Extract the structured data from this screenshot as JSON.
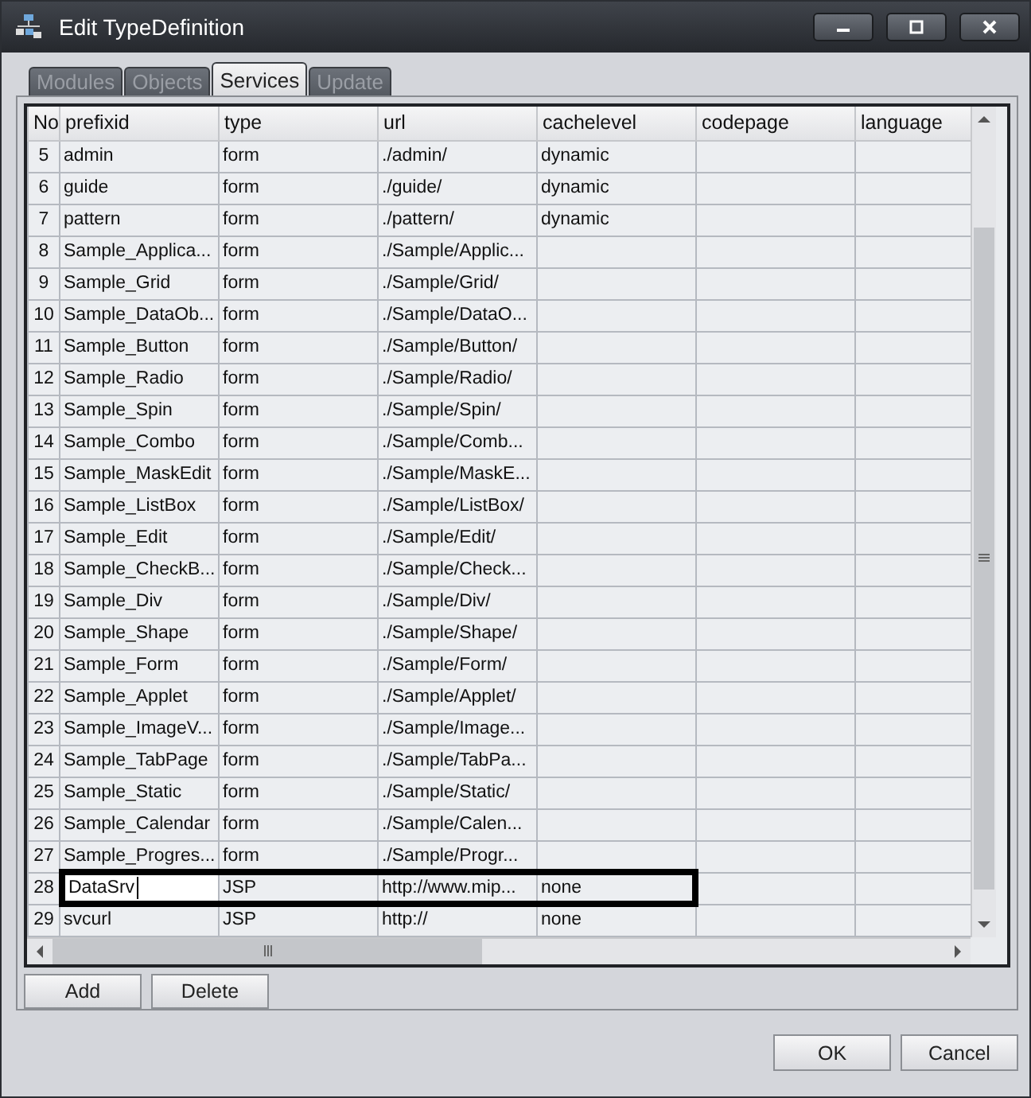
{
  "window": {
    "title": "Edit TypeDefinition"
  },
  "tabs": [
    {
      "label": "Modules",
      "selected": false
    },
    {
      "label": "Objects",
      "selected": false
    },
    {
      "label": "Services",
      "selected": true
    },
    {
      "label": "Update",
      "selected": false
    }
  ],
  "table": {
    "columns": [
      "No",
      "prefixid",
      "type",
      "url",
      "cachelevel",
      "codepage",
      "language"
    ],
    "rows": [
      {
        "no": "5",
        "prefixid": "admin",
        "type": "form",
        "url": "./admin/",
        "cachelevel": "dynamic",
        "editing": false,
        "highlighted": false
      },
      {
        "no": "6",
        "prefixid": "guide",
        "type": "form",
        "url": "./guide/",
        "cachelevel": "dynamic",
        "editing": false,
        "highlighted": false
      },
      {
        "no": "7",
        "prefixid": "pattern",
        "type": "form",
        "url": "./pattern/",
        "cachelevel": "dynamic",
        "editing": false,
        "highlighted": false
      },
      {
        "no": "8",
        "prefixid": "Sample_Applica...",
        "type": "form",
        "url": "./Sample/Applic...",
        "editing": false,
        "highlighted": false
      },
      {
        "no": "9",
        "prefixid": "Sample_Grid",
        "type": "form",
        "url": "./Sample/Grid/",
        "editing": false,
        "highlighted": false
      },
      {
        "no": "10",
        "prefixid": "Sample_DataOb...",
        "type": "form",
        "url": "./Sample/DataO...",
        "editing": false,
        "highlighted": false
      },
      {
        "no": "11",
        "prefixid": "Sample_Button",
        "type": "form",
        "url": "./Sample/Button/",
        "editing": false,
        "highlighted": false
      },
      {
        "no": "12",
        "prefixid": "Sample_Radio",
        "type": "form",
        "url": "./Sample/Radio/",
        "editing": false,
        "highlighted": false
      },
      {
        "no": "13",
        "prefixid": "Sample_Spin",
        "type": "form",
        "url": "./Sample/Spin/",
        "editing": false,
        "highlighted": false
      },
      {
        "no": "14",
        "prefixid": "Sample_Combo",
        "type": "form",
        "url": "./Sample/Comb...",
        "editing": false,
        "highlighted": false
      },
      {
        "no": "15",
        "prefixid": "Sample_MaskEdit",
        "type": "form",
        "url": "./Sample/MaskE...",
        "editing": false,
        "highlighted": false
      },
      {
        "no": "16",
        "prefixid": "Sample_ListBox",
        "type": "form",
        "url": "./Sample/ListBox/",
        "editing": false,
        "highlighted": false
      },
      {
        "no": "17",
        "prefixid": "Sample_Edit",
        "type": "form",
        "url": "./Sample/Edit/",
        "editing": false,
        "highlighted": false
      },
      {
        "no": "18",
        "prefixid": "Sample_CheckB...",
        "type": "form",
        "url": "./Sample/Check...",
        "editing": false,
        "highlighted": false
      },
      {
        "no": "19",
        "prefixid": "Sample_Div",
        "type": "form",
        "url": "./Sample/Div/",
        "editing": false,
        "highlighted": false
      },
      {
        "no": "20",
        "prefixid": "Sample_Shape",
        "type": "form",
        "url": "./Sample/Shape/",
        "editing": false,
        "highlighted": false
      },
      {
        "no": "21",
        "prefixid": "Sample_Form",
        "type": "form",
        "url": "./Sample/Form/",
        "editing": false,
        "highlighted": false
      },
      {
        "no": "22",
        "prefixid": "Sample_Applet",
        "type": "form",
        "url": "./Sample/Applet/",
        "editing": false,
        "highlighted": false
      },
      {
        "no": "23",
        "prefixid": "Sample_ImageV...",
        "type": "form",
        "url": "./Sample/Image...",
        "editing": false,
        "highlighted": false
      },
      {
        "no": "24",
        "prefixid": "Sample_TabPage",
        "type": "form",
        "url": "./Sample/TabPa...",
        "editing": false,
        "highlighted": false
      },
      {
        "no": "25",
        "prefixid": "Sample_Static",
        "type": "form",
        "url": "./Sample/Static/",
        "editing": false,
        "highlighted": false
      },
      {
        "no": "26",
        "prefixid": "Sample_Calendar",
        "type": "form",
        "url": "./Sample/Calen...",
        "editing": false,
        "highlighted": false
      },
      {
        "no": "27",
        "prefixid": "Sample_Progres...",
        "type": "form",
        "url": "./Sample/Progr...",
        "editing": false,
        "highlighted": false
      },
      {
        "no": "28",
        "prefixid": "DataSrv",
        "type": "JSP",
        "url": "http://www.mip...",
        "cachelevel": "none",
        "editing": true,
        "highlighted": true
      },
      {
        "no": "29",
        "prefixid": "svcurl",
        "type": "JSP",
        "url": "http://",
        "cachelevel": "none",
        "editing": false,
        "highlighted": false
      }
    ]
  },
  "grid_buttons": [
    "Add",
    "Delete"
  ],
  "buttons": [
    "OK",
    "Cancel"
  ]
}
